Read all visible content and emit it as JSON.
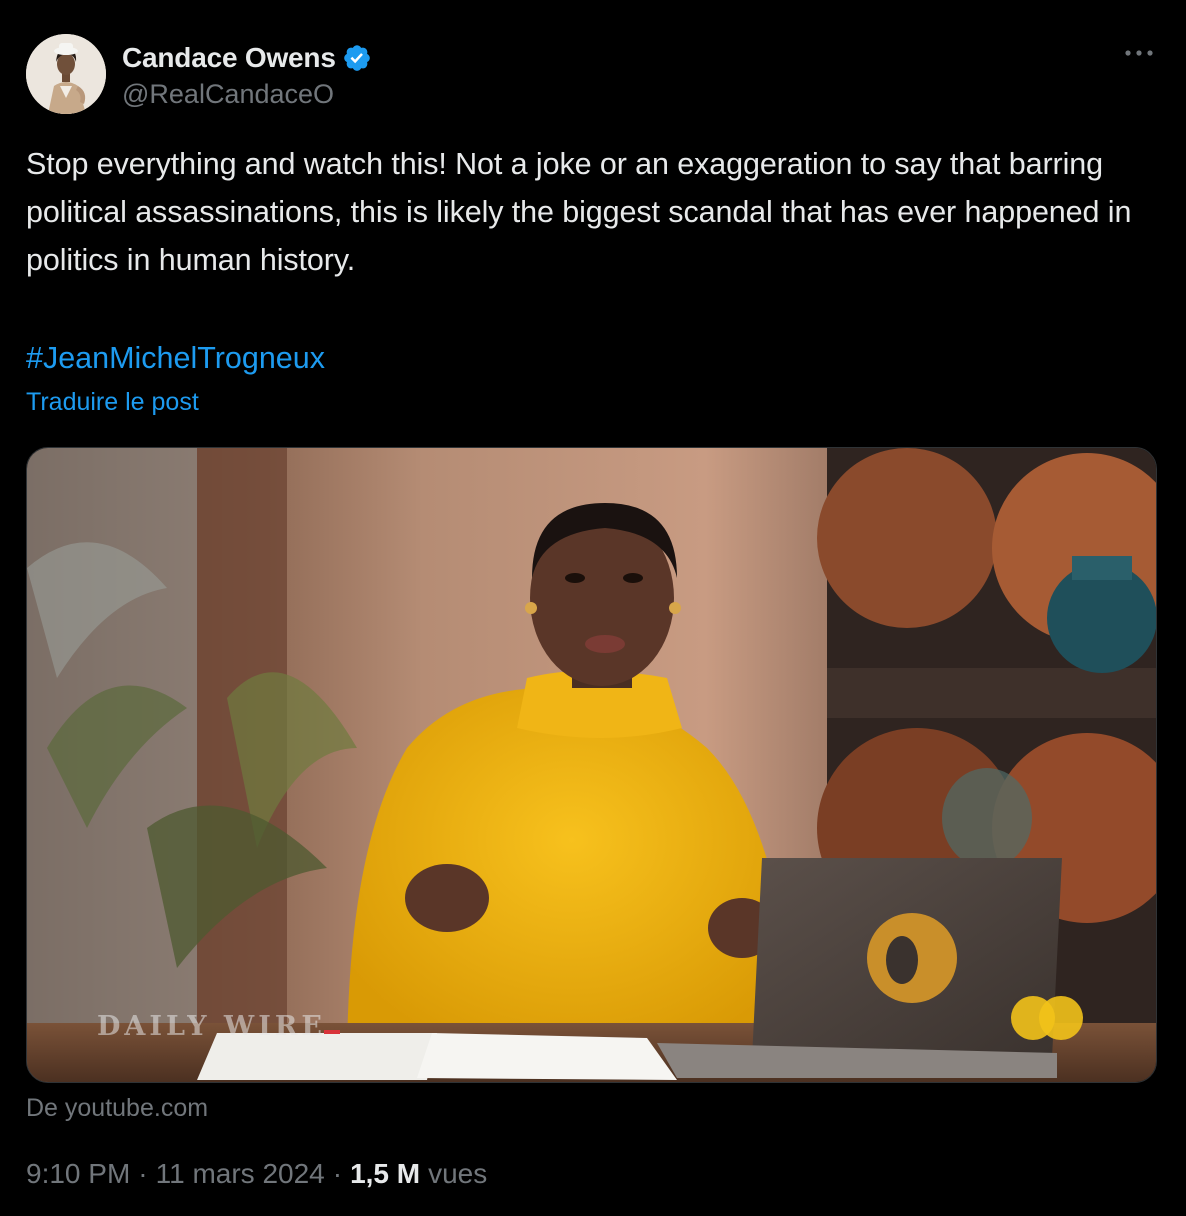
{
  "author": {
    "display_name": "Candace Owens",
    "handle": "@RealCandaceO",
    "verified": true,
    "avatar_icon": "profile-photo"
  },
  "menu": {
    "more_icon": "more-horizontal-icon"
  },
  "tweet": {
    "text": "Stop everything and watch this! Not a joke or an exaggeration to say that barring political assassinations, this is likely the biggest scandal that has ever happened in politics in human history.",
    "hashtag": "#JeanMichelTrogneux",
    "translate_label": "Traduire le post"
  },
  "media": {
    "type": "video",
    "watermark": "DAILY WIRE",
    "source_label": "De youtube.com"
  },
  "meta": {
    "time": "9:10 PM",
    "separator": "·",
    "date": "11 mars 2024",
    "views_count": "1,5 M",
    "views_label": "vues"
  },
  "colors": {
    "background": "#000000",
    "text_primary": "#e7e9ea",
    "text_secondary": "#71767b",
    "link": "#1d9bf0",
    "verified_badge": "#1d9bf0",
    "border": "#2f3336"
  }
}
